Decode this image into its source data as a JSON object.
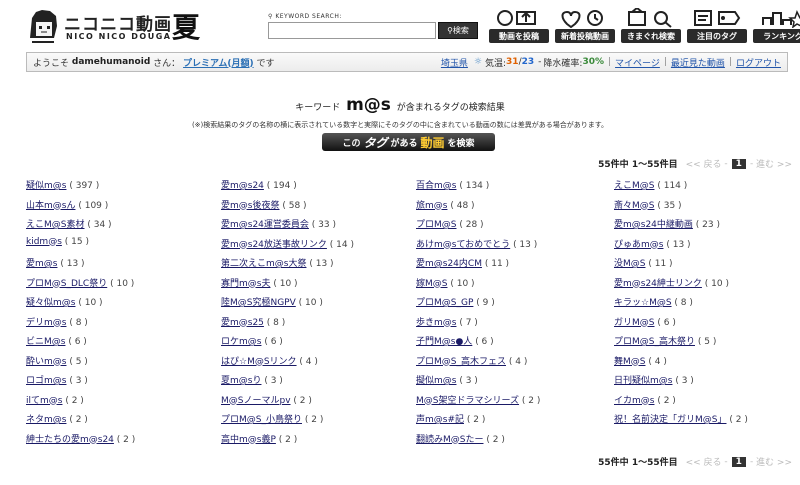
{
  "header": {
    "logo_main": "ニコニコ動画",
    "logo_sub": "NICO NICO DOUGA",
    "logo_season": "夏",
    "search_label": "KEYWORD SEARCH:",
    "search_value": "",
    "search_button": "検索",
    "nav": [
      {
        "label": "動画を投稿",
        "icon": "upload-icon"
      },
      {
        "label": "新着投稿動画",
        "icon": "new-videos-icon"
      },
      {
        "label": "きまぐれ検索",
        "icon": "random-search-icon"
      },
      {
        "label": "注目のタグ",
        "icon": "hot-tags-icon"
      },
      {
        "label": "ランキング",
        "icon": "ranking-icon"
      }
    ]
  },
  "userbar": {
    "welcome": "ようこそ",
    "username": "damehumanoid",
    "honorific": "さん：",
    "membership": "プレミアム(月額)",
    "desu": "です",
    "prefecture": "埼玉県",
    "weather_icon": "weather-icon",
    "temp_label": "気温:",
    "temp_max": "31",
    "temp_min": "23",
    "rain_label": "降水確率:",
    "rain_value": "30%",
    "links": [
      "マイページ",
      "最近見た動画",
      "ログアウト"
    ]
  },
  "result": {
    "prefix": "キーワード",
    "keyword": "m@s",
    "suffix": "が含まれるタグの検索結果",
    "note": "(※)検索結果のタグの名称の横に表示されている数字と実際にそのタグの中に含まれている動画の数には差異がある場合があります。",
    "button_pre": "この",
    "button_tag": "タグ",
    "button_mid": "がある",
    "button_video": "動画",
    "button_post": "を検索"
  },
  "pager": {
    "count_text": "55件中 1〜55件目",
    "prev": "<< 戻る",
    "current": "1",
    "next": "進む >>"
  },
  "tags": [
    [
      "疑似m@s",
      "( 397 )"
    ],
    [
      "愛m@s24",
      "( 194 )"
    ],
    [
      "百合m@s",
      "( 134 )"
    ],
    [
      "えこM@S",
      "( 114 )"
    ],
    [
      "山本m@sん",
      "( 109 )"
    ],
    [
      "愛m@s後夜祭",
      "( 58 )"
    ],
    [
      "旅m@s",
      "( 48 )"
    ],
    [
      "斎々M@S",
      "( 35 )"
    ],
    [
      "えこM@S素材",
      "( 34 )"
    ],
    [
      "愛m@s24運営委員会",
      "( 33 )"
    ],
    [
      "プロM@S",
      "( 28 )"
    ],
    [
      "愛m@s24中継動画",
      "( 23 )"
    ],
    [
      "kidm@s",
      "( 15 )"
    ],
    [
      "愛m@s24放送事故リンク",
      "( 14 )"
    ],
    [
      "あけm@sておめでとう",
      "( 13 )"
    ],
    [
      "ぴゅあm@s",
      "( 13 )"
    ],
    [
      "愛m@s",
      "( 13 )"
    ],
    [
      "第二次えこm@s大祭",
      "( 13 )"
    ],
    [
      "愛m@s24内CM",
      "( 11 )"
    ],
    [
      "没M@S",
      "( 11 )"
    ],
    [
      "プロM@S_DLC祭り",
      "( 10 )"
    ],
    [
      "寡門m@s夫",
      "( 10 )"
    ],
    [
      "嫁M@S",
      "( 10 )"
    ],
    [
      "愛m@s24紳士リンク",
      "( 10 )"
    ],
    [
      "疑々似m@s",
      "( 10 )"
    ],
    [
      "陸M@S究極NGPV",
      "( 10 )"
    ],
    [
      "プロM@S_GP",
      "( 9 )"
    ],
    [
      "キラッ☆M@S",
      "( 8 )"
    ],
    [
      "デリm@s",
      "( 8 )"
    ],
    [
      "愛m@s25",
      "( 8 )"
    ],
    [
      "歩きm@s",
      "( 7 )"
    ],
    [
      "ガリM@S",
      "( 6 )"
    ],
    [
      "ビニM@s",
      "( 6 )"
    ],
    [
      "ロケm@s",
      "( 6 )"
    ],
    [
      "子門M@s●人",
      "( 6 )"
    ],
    [
      "プロM@S_高木祭り",
      "( 5 )"
    ],
    [
      "酔いm@s",
      "( 5 )"
    ],
    [
      "はぴ☆M@Sリンク",
      "( 4 )"
    ],
    [
      "プロM@S_高木フェス",
      "( 4 )"
    ],
    [
      "舞M@S",
      "( 4 )"
    ],
    [
      "ロゴm@s",
      "( 3 )"
    ],
    [
      "夏m@sり",
      "( 3 )"
    ],
    [
      "擬似m@s",
      "( 3 )"
    ],
    [
      "日刊疑似m@s",
      "( 3 )"
    ],
    [
      "ilてm@s",
      "( 2 )"
    ],
    [
      "M@Sノーマルpv",
      "( 2 )"
    ],
    [
      "M@S架空ドラマシリーズ",
      "( 2 )"
    ],
    [
      "イカm@s",
      "( 2 )"
    ],
    [
      "ネタm@s",
      "( 2 )"
    ],
    [
      "プロM@S_小鳥祭り",
      "( 2 )"
    ],
    [
      "声m@s#記",
      "( 2 )"
    ],
    [
      "祝！名前決定「ガリM@S」",
      "( 2 )"
    ],
    [
      "紳士たちの愛m@s24",
      "( 2 )"
    ],
    [
      "高中m@s義P",
      "( 2 )"
    ],
    [
      "翻読みM@Sたー",
      "( 2 )"
    ]
  ]
}
